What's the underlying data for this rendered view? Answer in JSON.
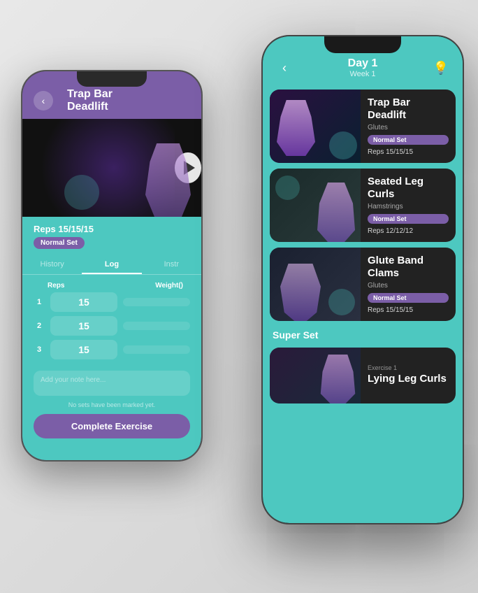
{
  "phone_left": {
    "header": {
      "title": "Trap Bar Deadlift",
      "back_label": "‹"
    },
    "exercise": {
      "reps_label": "Reps 15/15/15",
      "badge": "Normal Set"
    },
    "tabs": [
      {
        "label": "History",
        "active": false
      },
      {
        "label": "Log",
        "active": true
      },
      {
        "label": "Instr",
        "active": false
      }
    ],
    "log_columns": {
      "reps": "Reps",
      "weight": "Weight()"
    },
    "sets": [
      {
        "num": "1",
        "reps": "15",
        "weight": ""
      },
      {
        "num": "2",
        "reps": "15",
        "weight": ""
      },
      {
        "num": "3",
        "reps": "15",
        "weight": ""
      }
    ],
    "note_placeholder": "Add your note here...",
    "no_sets_label": "No sets have been marked yet.",
    "complete_btn": "Complete Exercise"
  },
  "phone_right": {
    "header": {
      "day": "Day 1",
      "week": "Week 1",
      "back_label": "‹",
      "lightbulb": "💡"
    },
    "exercises": [
      {
        "name": "Trap Bar Deadlift",
        "muscle": "Glutes",
        "badge": "Normal Set",
        "reps": "Reps 15/15/15",
        "image_type": "dark_purple"
      },
      {
        "name": "Seated Leg Curls",
        "muscle": "Hamstrings",
        "badge": "Normal Set",
        "reps": "Reps 12/12/12",
        "image_type": "gym"
      },
      {
        "name": "Glute Band Clams",
        "muscle": "Glutes",
        "badge": "Normal Set",
        "reps": "Reps 15/15/15",
        "image_type": "gym2"
      }
    ],
    "super_set_label": "Super Set",
    "partial_exercise": {
      "exercise_num": "Exercise 1",
      "name": "Lying Leg Curls"
    }
  }
}
